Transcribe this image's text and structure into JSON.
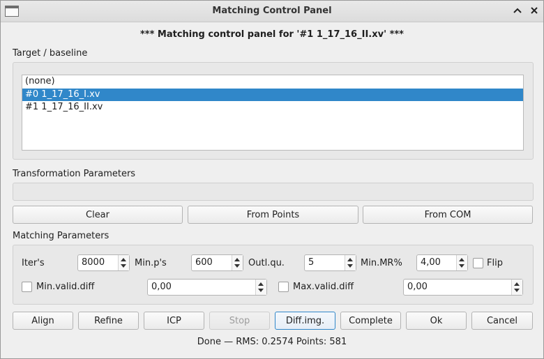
{
  "window": {
    "title": "Matching Control Panel",
    "heading": "*** Matching control panel for '#1 1_17_16_II.xv' ***",
    "minimize_glyph": "^",
    "close_glyph": "×"
  },
  "target": {
    "label": "Target / baseline",
    "items": [
      {
        "label": "(none)",
        "selected": false
      },
      {
        "label": "#0 1_17_16_I.xv",
        "selected": true
      },
      {
        "label": "#1 1_17_16_II.xv",
        "selected": false
      }
    ]
  },
  "transformation": {
    "label": "Transformation Parameters",
    "value": "",
    "buttons": {
      "clear": "Clear",
      "from_points": "From Points",
      "from_com": "From COM"
    }
  },
  "matching": {
    "label": "Matching Parameters",
    "iters": {
      "label": "Iter's",
      "value": "8000"
    },
    "min_ps": {
      "label": "Min.p's",
      "value": "600"
    },
    "outl_qu": {
      "label": "Outl.qu.",
      "value": "5"
    },
    "min_mr": {
      "label": "Min.MR%",
      "value": "4,00"
    },
    "flip": {
      "label": "Flip",
      "checked": false
    },
    "min_valid_diff": {
      "label": "Min.valid.diff",
      "checked": false,
      "value": "0,00"
    },
    "max_valid_diff": {
      "label": "Max.valid.diff",
      "checked": false,
      "value": "0,00"
    }
  },
  "actions": {
    "align": "Align",
    "refine": "Refine",
    "icp": "ICP",
    "stop": "Stop",
    "diff_img": "Diff.img.",
    "complete": "Complete",
    "ok": "Ok",
    "cancel": "Cancel"
  },
  "status": "Done — RMS: 0.2574  Points: 581",
  "colors": {
    "selection": "#3087c9",
    "focus": "#3087c9"
  }
}
